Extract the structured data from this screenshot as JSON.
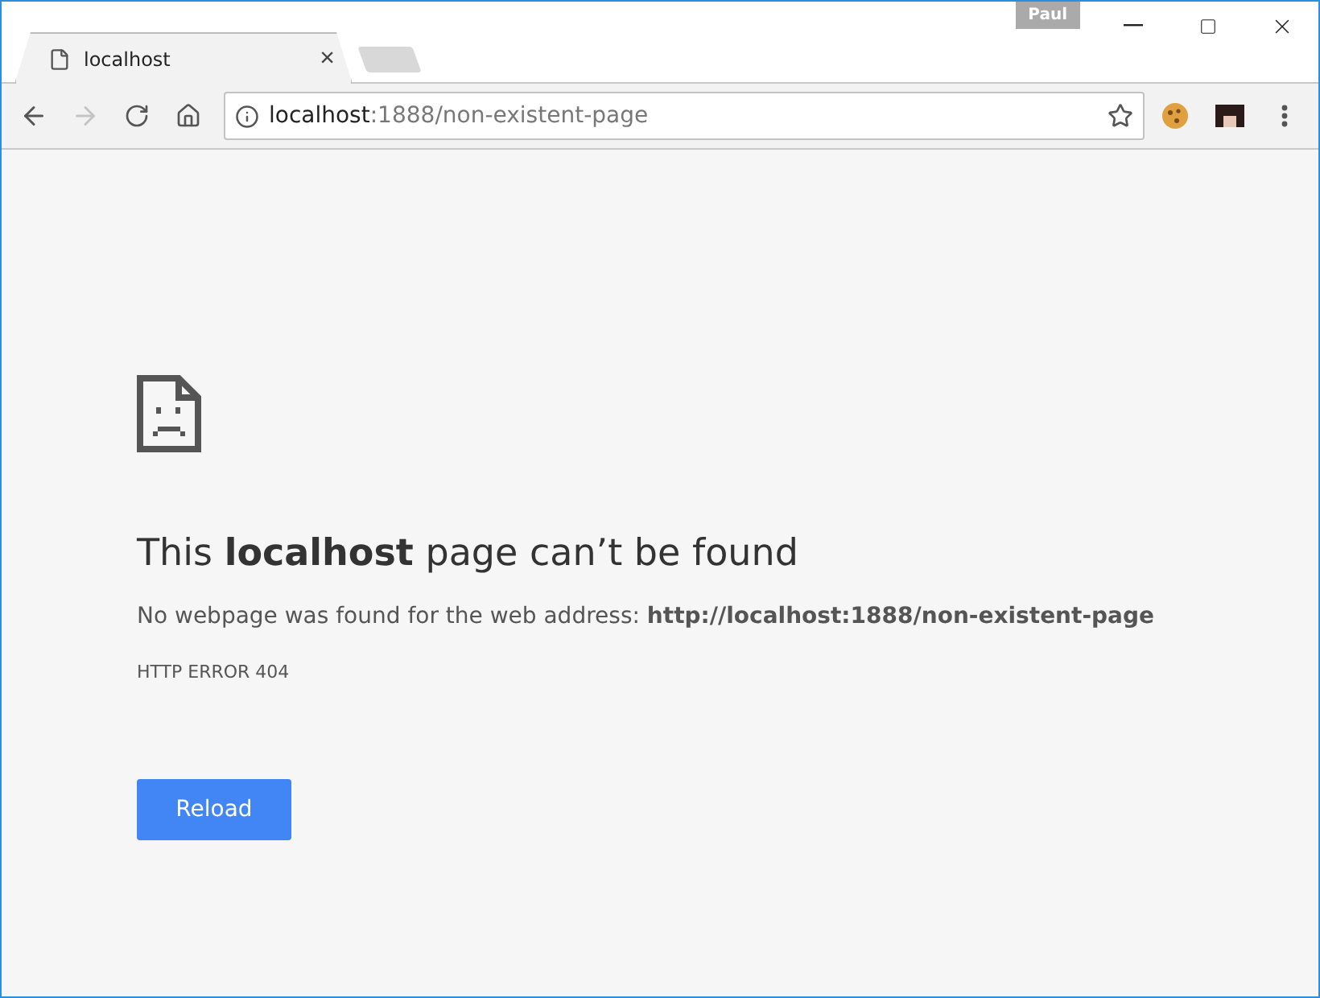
{
  "window": {
    "profile": "Paul"
  },
  "tabs": [
    {
      "title": "localhost",
      "close": "×",
      "selected": true
    }
  ],
  "toolbar": {
    "back_disabled": false,
    "forward_disabled": true,
    "address": {
      "host": "localhost",
      "rest": ":1888/non-existent-page"
    }
  },
  "error": {
    "heading": "This **localhost** page can’t be found",
    "message": "No webpage was found for the web address: **http://localhost:1888/non-existent-page**",
    "code": "HTTP ERROR 404",
    "button": "Reload"
  }
}
